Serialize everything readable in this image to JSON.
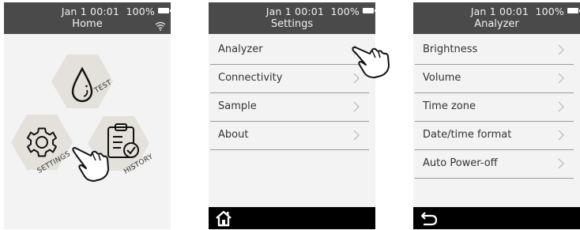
{
  "status": {
    "datetime": "Jan  1  00:01",
    "battery": "100%"
  },
  "home": {
    "title": "Home",
    "tiles": {
      "test": "TEST",
      "settings": "SETTINGS",
      "history": "HISTORY"
    }
  },
  "settings": {
    "title": "Settings",
    "items": [
      "Analyzer",
      "Connectivity",
      "Sample",
      "About"
    ]
  },
  "analyzer": {
    "title": "Analyzer",
    "items": [
      "Brightness",
      "Volume",
      "Time zone",
      "Date/time format",
      "Auto Power-off"
    ]
  },
  "icons": {
    "wifi": "wifi-icon",
    "battery": "battery-icon",
    "chevron": "chevron-right-icon",
    "home": "home-icon",
    "back": "back-arrow-icon",
    "drop": "drop-icon",
    "gear": "gear-icon",
    "clipboard": "clipboard-check-icon",
    "hand": "pointing-hand-icon"
  },
  "colors": {
    "statusbar": "#4a4a4a",
    "screen": "#f3f3f3",
    "hexagon": "#e4e1da",
    "bottombar": "#000000"
  }
}
